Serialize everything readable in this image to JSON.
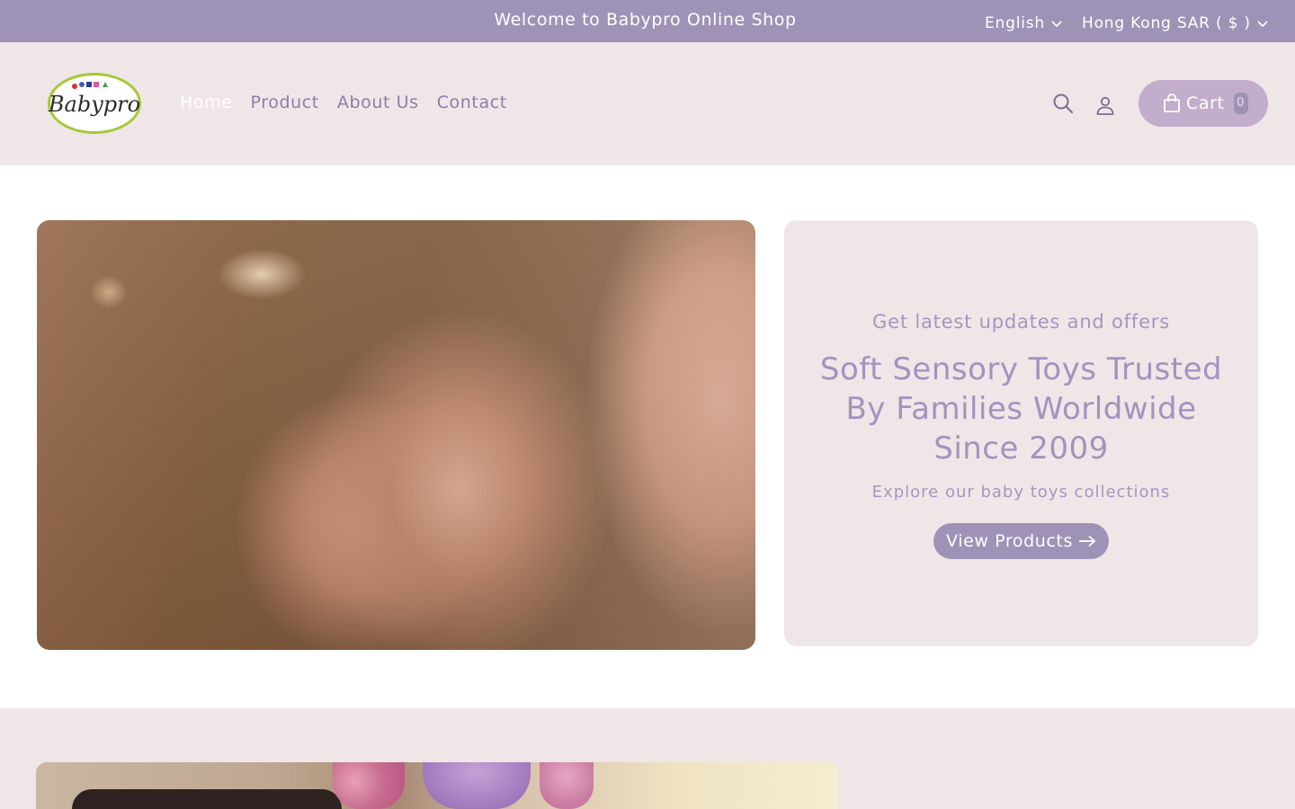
{
  "announcement": {
    "message": "Welcome to Babypro Online Shop",
    "language": "English",
    "currency": "Hong Kong SAR ( $ )"
  },
  "header": {
    "logo_text": "Babypro",
    "nav": [
      {
        "label": "Home",
        "active": true
      },
      {
        "label": "Product",
        "active": false
      },
      {
        "label": "About Us",
        "active": false
      },
      {
        "label": "Contact",
        "active": false
      }
    ],
    "icons": [
      "search-icon",
      "account-icon",
      "bag-icon"
    ],
    "cart": {
      "label": "Cart",
      "count": "0"
    }
  },
  "hero": {
    "subtitle": "Get latest updates and offers",
    "title": "Soft Sensory Toys Trusted By Families Worldwide Since 2009",
    "description": "Explore our baby toys collections",
    "button_label": "View Products"
  },
  "colors": {
    "accent": "#9e93b7",
    "header_bg": "#efe6e8",
    "cart_bg": "#c2adcc"
  }
}
